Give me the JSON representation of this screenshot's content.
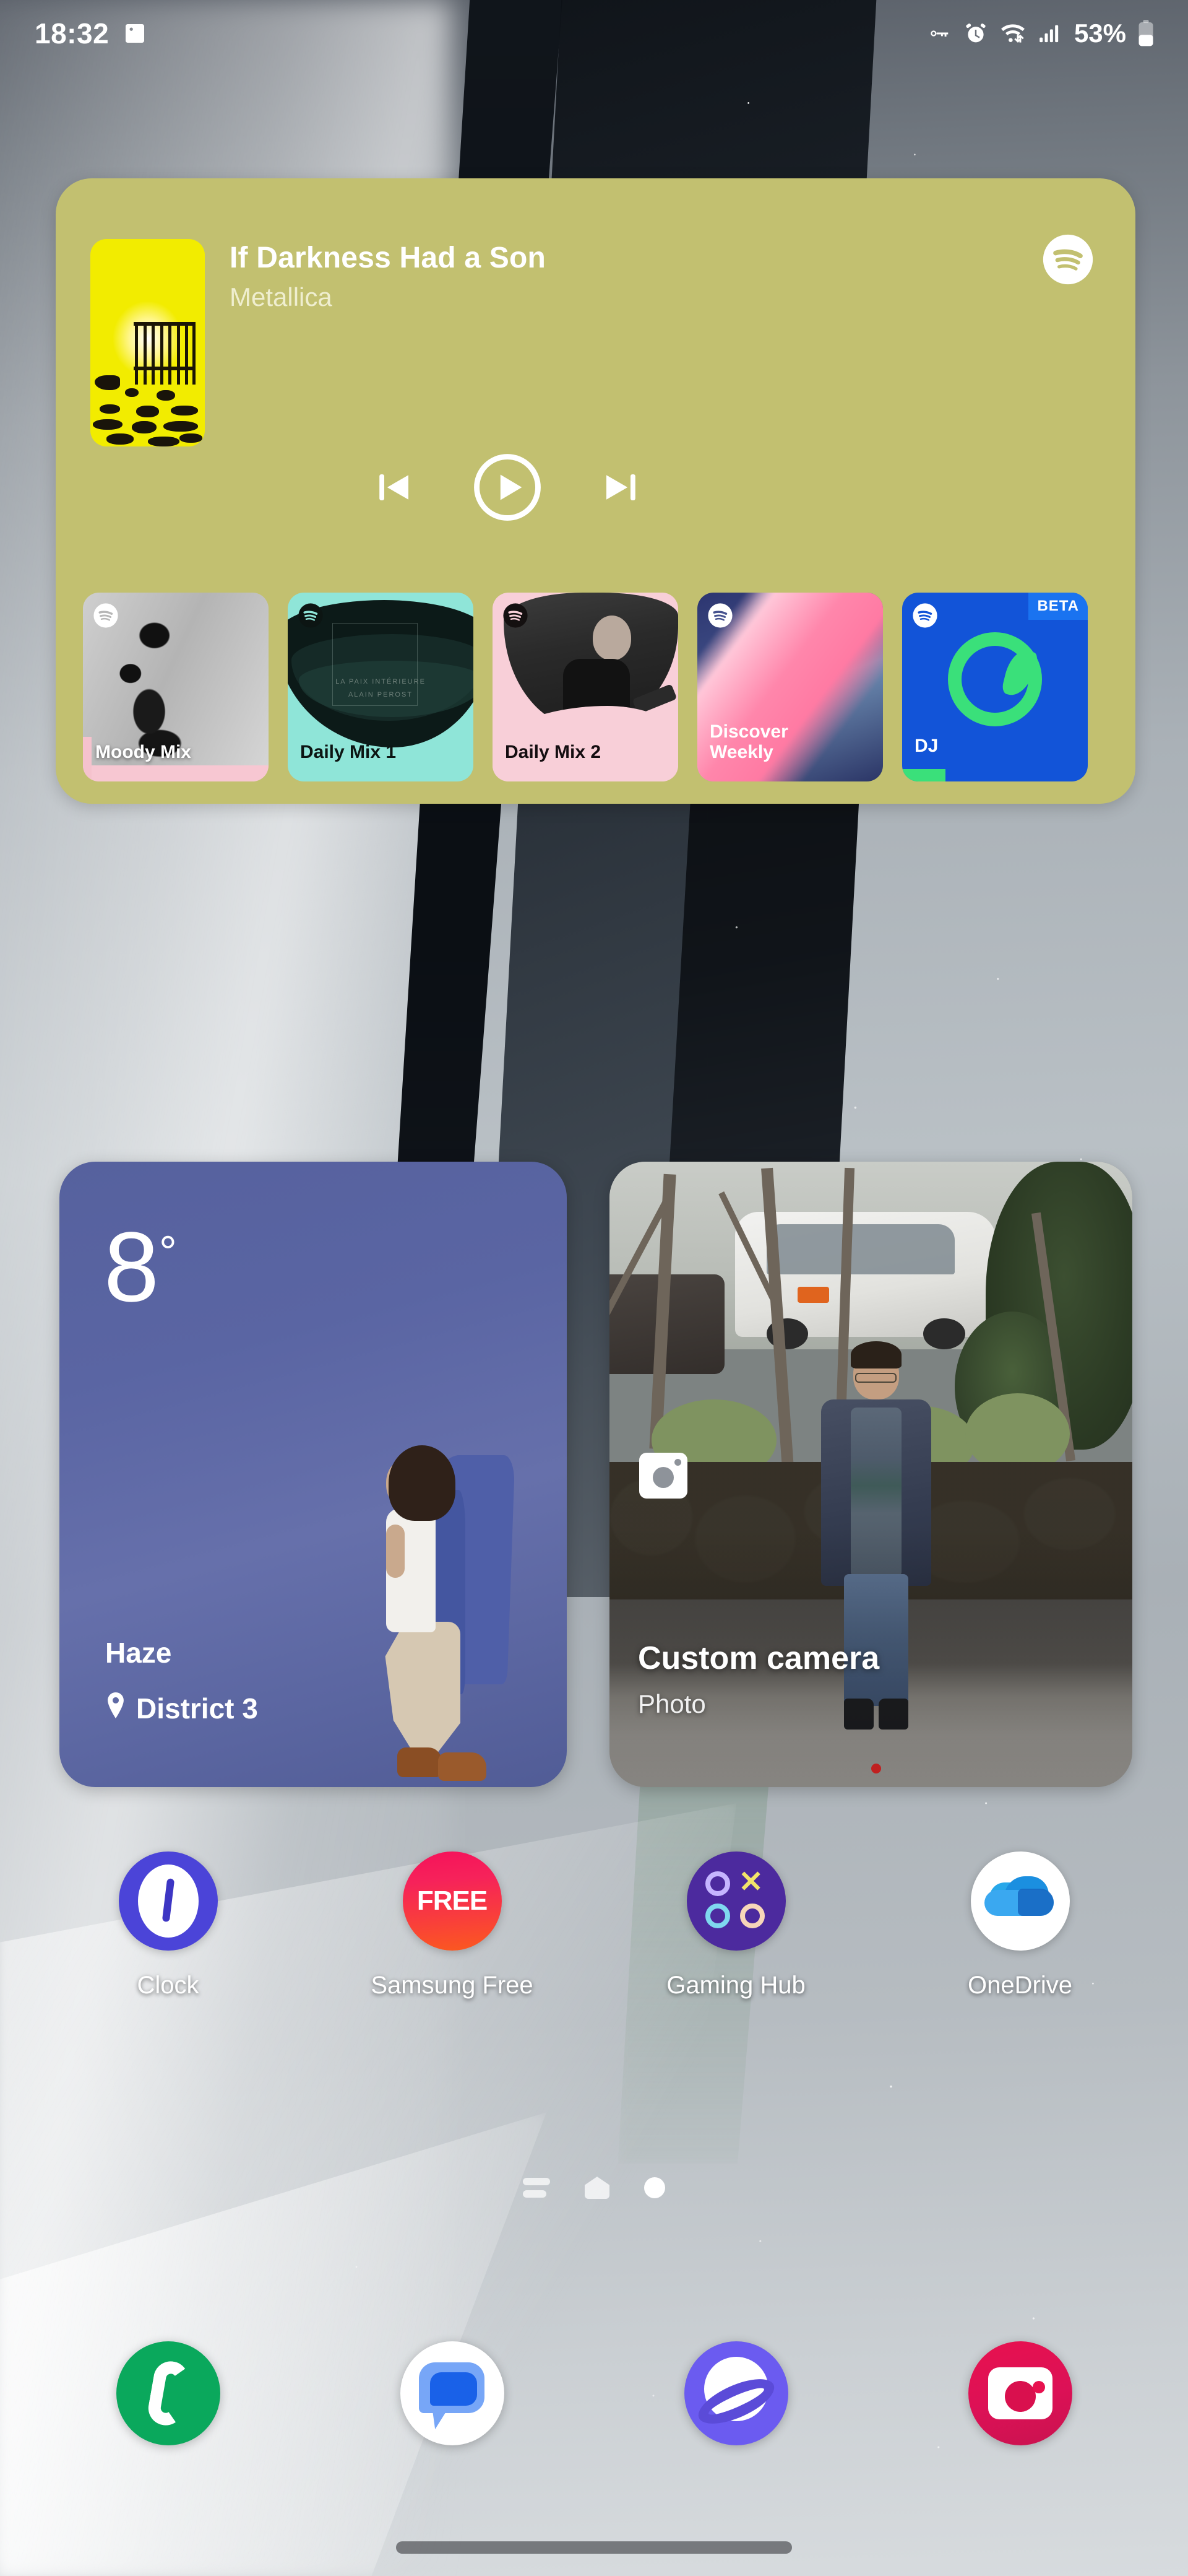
{
  "status_bar": {
    "time": "18:32",
    "battery_percent": "53%",
    "icons": {
      "gallery": "image-icon",
      "vpn": "vpn-key-icon",
      "alarm": "alarm-clock-icon",
      "wifi": "wifi-icon",
      "signal": "cellular-signal-icon",
      "battery": "battery-icon"
    }
  },
  "spotify_widget": {
    "app": "Spotify",
    "accent_color": "#c2c070",
    "now_playing": {
      "track": "If Darkness Had a Son",
      "artist": "Metallica",
      "album_art": "72-seasons-yellow-crib",
      "controls": {
        "previous": "skip-previous",
        "play": "play",
        "next": "skip-next"
      }
    },
    "tiles": [
      {
        "label": "Moody Mix",
        "badge": "",
        "bg": "#c4c4c4"
      },
      {
        "label": "Daily Mix 1",
        "badge": "",
        "bg": "#8fe5d8"
      },
      {
        "label": "Daily Mix 2",
        "badge": "",
        "bg": "#f8cfd8"
      },
      {
        "label": "Discover\nWeekly",
        "badge": "",
        "bg": "#2c3570"
      },
      {
        "label": "DJ",
        "badge": "BETA",
        "bg": "#1254d8"
      }
    ]
  },
  "weather_widget": {
    "temperature": "8",
    "degree": "°",
    "condition": "Haze",
    "location": "District 3",
    "location_icon": "location-pin-icon"
  },
  "camera_widget": {
    "title": "Custom camera",
    "subtitle": "Photo",
    "icon": "camera-icon"
  },
  "app_row": [
    {
      "label": "Clock",
      "icon": "clock-app-icon",
      "color": "#4b44d8"
    },
    {
      "label": "Samsung Free",
      "icon": "samsung-free-app-icon",
      "color": "#f5125a",
      "text": "FREE"
    },
    {
      "label": "Gaming Hub",
      "icon": "gaming-hub-app-icon",
      "color": "#4c2a9e"
    },
    {
      "label": "OneDrive",
      "icon": "onedrive-app-icon",
      "color": "#ffffff"
    }
  ],
  "page_indicator": {
    "pages": [
      "news-page-icon",
      "home-page-icon",
      "current-page-dot"
    ],
    "current": 2
  },
  "dock": [
    {
      "label": "Phone",
      "icon": "phone-app-icon",
      "color": "#0aa85c"
    },
    {
      "label": "Messages",
      "icon": "messages-app-icon",
      "color": "#ffffff"
    },
    {
      "label": "Internet",
      "icon": "browser-app-icon",
      "color": "#6b5bf0"
    },
    {
      "label": "Camera",
      "icon": "camera-app-icon",
      "color": "#e8114f"
    }
  ],
  "nav_bar": {
    "gesture_pill": "home-gesture-pill"
  }
}
